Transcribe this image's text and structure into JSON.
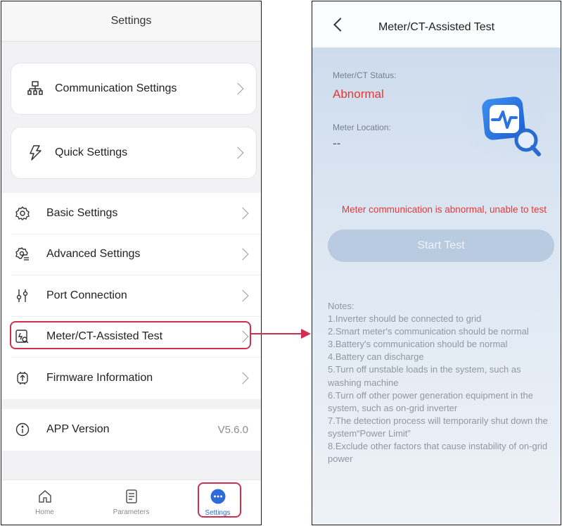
{
  "left": {
    "title": "Settings",
    "cards": [
      {
        "label": "Communication Settings",
        "icon": "network-icon"
      },
      {
        "label": "Quick Settings",
        "icon": "lightning-icon"
      }
    ],
    "group1": [
      {
        "label": "Basic Settings",
        "icon": "gear-icon"
      },
      {
        "label": "Advanced Settings",
        "icon": "advanced-gear-icon"
      },
      {
        "label": "Port Connection",
        "icon": "port-icon"
      },
      {
        "label": "Meter/CT-Assisted Test",
        "icon": "meter-test-icon"
      },
      {
        "label": "Firmware Information",
        "icon": "firmware-icon"
      }
    ],
    "group2": [
      {
        "label": "APP Version",
        "value": "V5.6.0",
        "icon": "info-icon"
      }
    ],
    "tabs": [
      {
        "label": "Home",
        "icon": "home-icon"
      },
      {
        "label": "Parameters",
        "icon": "document-icon"
      },
      {
        "label": "Settings",
        "icon": "more-icon"
      }
    ],
    "accent": "#2f6bd8",
    "highlight_color": "#d03050"
  },
  "right": {
    "title": "Meter/CT-Assisted Test",
    "status_label": "Meter/CT Status:",
    "status_value": "Abnormal",
    "location_label": "Meter Location:",
    "location_value": "--",
    "error_message": "Meter communication is abnormal, unable to test",
    "start_button": "Start Test",
    "notes_title": "Notes:",
    "notes": [
      "1.Inverter should be connected to grid",
      "2.Smart meter's communication should be normal",
      "3.Battery's communication should be normal",
      "4.Battery can discharge",
      "5.Turn off unstable loads in the system, such as washing machine",
      "6.Turn off other power generation equipment in the system, such as on-grid inverter",
      "7.The detection process will temporarily shut down the system“Power Limit”",
      "8.Exclude other factors that cause instability of on-grid power"
    ],
    "error_color": "#e53935"
  }
}
